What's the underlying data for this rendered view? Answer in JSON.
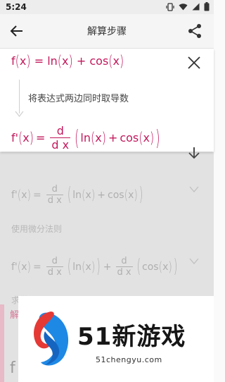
{
  "status": {
    "time": "5:24"
  },
  "appbar": {
    "title": "解算步骤"
  },
  "card": {
    "eq1": {
      "f": "f",
      "x1": "x",
      "eq": "=",
      "ln": "ln",
      "x2": "x",
      "plus": "+",
      "cos": "cos",
      "x3": "x"
    },
    "step_text": "将表达式两边同时取导数",
    "eq2": {
      "fp": "f'",
      "x1": "x",
      "eq": "=",
      "num": "d",
      "den": "d x",
      "ln": "ln",
      "x2": "x",
      "plus": "+",
      "cos": "cos",
      "x3": "x"
    }
  },
  "dimmed": {
    "eq3": {
      "fp": "f'",
      "x1": "x",
      "eq": "=",
      "num": "d",
      "den": "d x",
      "ln": "ln",
      "x2": "x",
      "plus": "+",
      "cos": "cos",
      "x3": "x"
    },
    "label1": "使用微分法则",
    "eq4": {
      "fp": "f'",
      "x1": "x",
      "eq": "=",
      "num1": "d",
      "den1": "d x",
      "ln": "ln",
      "x2": "x",
      "plus": "+",
      "num2": "d",
      "den2": "d x",
      "cos": "cos",
      "x3": "x"
    },
    "label2": "求微分",
    "red_label": "解",
    "partial_char": "f"
  },
  "watermark": {
    "title": "51新游戏",
    "domain": "51chengyu.com"
  },
  "colors": {
    "accent": "#c2185b",
    "dim": "#b9b9b9"
  }
}
